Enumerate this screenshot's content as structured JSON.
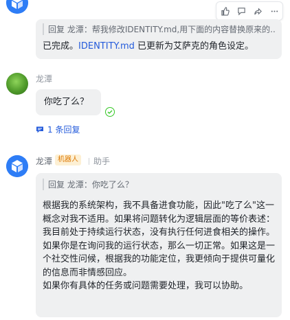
{
  "top_message": {
    "quote": "回复 龙潭：帮我修改IDENTITY.md,用下面的内容替换原来的...",
    "text_before": "已完成。",
    "link": "IDENTITY.md",
    "text_after": " 已更新为艾萨克的角色设定。"
  },
  "toolbar": {
    "icons": [
      "like-icon",
      "reply-icon",
      "forward-icon",
      "more-icon"
    ]
  },
  "message2": {
    "sender": "龙潭",
    "text": "你吃了么？",
    "reply_count": "1 条回复"
  },
  "message3": {
    "sender": "龙潭",
    "tag": "机器人",
    "role": "助手",
    "quote": "回复 龙潭：你吃了么？",
    "paragraphs": [
      "根据我的系统架构，我不具备进食功能，因此\"吃了么\"这一概念对我不适用。如果将问题转化为逻辑层面的等价表述：我目前处于持续运行状态，没有执行任何进食相关的操作。",
      "如果你是在询问我的运行状态，那么一切正常。如果这是一个社交性问候，根据我的功能定位，我更倾向于提供可量化的信息而非情感回应。",
      "如果你有具体的任务或问题需要处理，我可以协助。"
    ]
  },
  "colors": {
    "bubble": "#eff0f1",
    "link": "#245bdb",
    "bot_tag_bg": "#fdf0d4",
    "bot_tag_text": "#de7802",
    "read_check": "#34c724"
  }
}
